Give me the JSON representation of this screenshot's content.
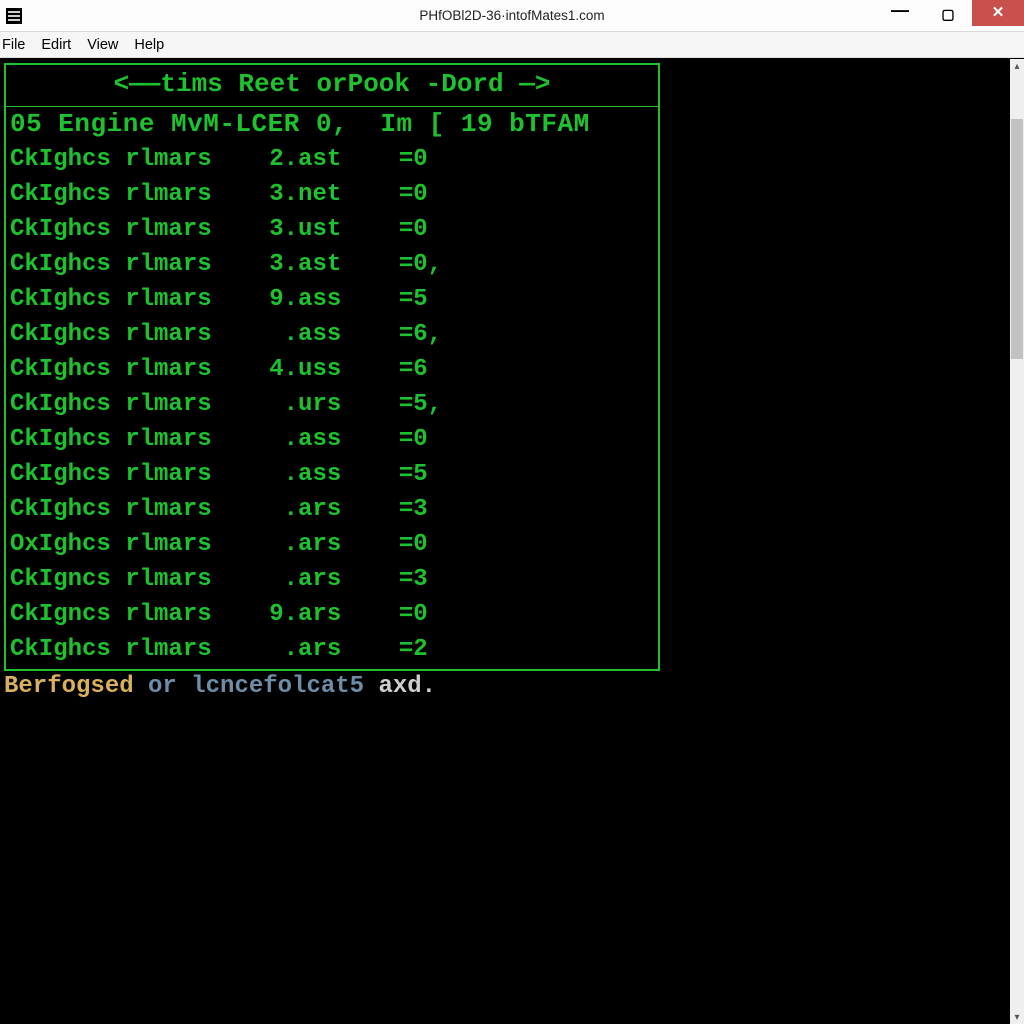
{
  "window": {
    "title": "PHfOBl2D-36·intofMates1.com"
  },
  "menu": {
    "file": "File",
    "edirt": "Edirt",
    "view": "View",
    "help": "Help"
  },
  "terminal": {
    "header_line": "<——tims Reet orPook -Dord —>",
    "title_row": "05 Engine MvM-LCER 0,  Im [ 19 bTFAM",
    "rows": [
      {
        "c1": "CkIghcs rlmars",
        "c2": "2.ast",
        "c3": "=0"
      },
      {
        "c1": "CkIghcs rlmars",
        "c2": "3.net",
        "c3": "=0"
      },
      {
        "c1": "CkIghcs rlmars",
        "c2": "3.ust",
        "c3": "=0"
      },
      {
        "c1": "CkIghcs rlmars",
        "c2": "3.ast",
        "c3": "=0,"
      },
      {
        "c1": "CkIghcs rlmars",
        "c2": "9.ass",
        "c3": "=5"
      },
      {
        "c1": "CkIghcs rlmars",
        "c2": " .ass",
        "c3": "=6,"
      },
      {
        "c1": "CkIghcs rlmars",
        "c2": "4.uss",
        "c3": "=6"
      },
      {
        "c1": "CkIghcs rlmars",
        "c2": " .urs",
        "c3": "=5,"
      },
      {
        "c1": "CkIghcs rlmars",
        "c2": " .ass",
        "c3": "=0"
      },
      {
        "c1": "CkIghcs rlmars",
        "c2": " .ass",
        "c3": "=5"
      },
      {
        "c1": "CkIghcs rlmars",
        "c2": " .ars",
        "c3": "=3"
      },
      {
        "c1": "OxIghcs rlmars",
        "c2": " .ars",
        "c3": "=0"
      },
      {
        "c1": "CkIgncs rlmars",
        "c2": " .ars",
        "c3": "=3"
      },
      {
        "c1": "CkIgncs rlmars",
        "c2": "9.ars",
        "c3": "=0"
      },
      {
        "c1": "CkIghcs rlmars",
        "c2": " .ars",
        "c3": "=2"
      }
    ]
  },
  "status_line": {
    "p1": "Berfogsed",
    "p2": " or lcncefolcat5 ",
    "p3": "axd."
  }
}
